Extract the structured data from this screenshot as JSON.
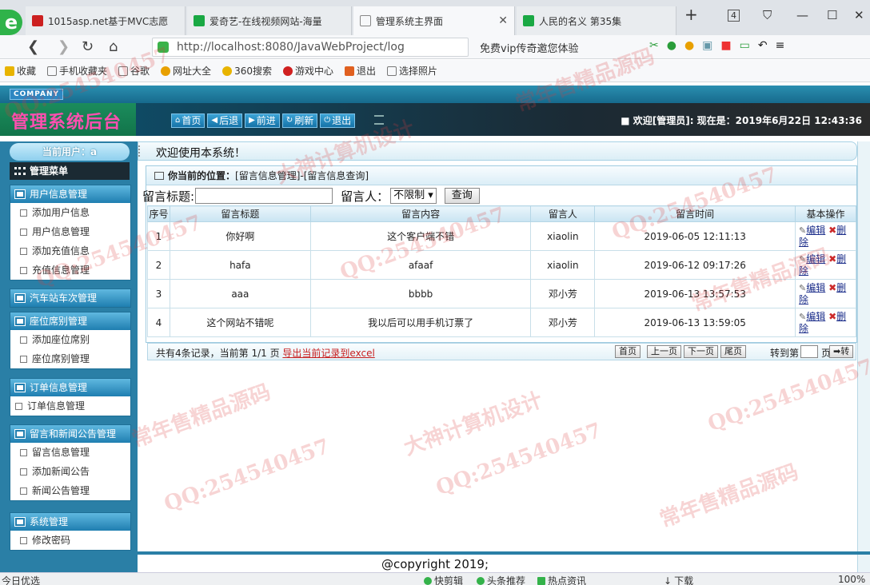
{
  "browser": {
    "tabs": [
      {
        "title": "1015asp.net基于MVC志愿",
        "color": "#cc2020",
        "active": false
      },
      {
        "title": "爱奇艺-在线视频网站-海量",
        "color": "#19a843",
        "active": false
      },
      {
        "title": "管理系统主界面",
        "color": "#888888",
        "active": true
      },
      {
        "title": "人民的名义 第35集",
        "color": "#19a843",
        "active": false
      }
    ],
    "new_tab": "+",
    "tab_count": "4",
    "url": "http://localhost:8080/JavaWebProject/log",
    "ad_text": "免费vip传奇邀您体验",
    "favorites": [
      "收藏",
      "手机收藏夹",
      "谷歌",
      "网址大全",
      "360搜索",
      "游戏中心",
      "退出",
      "选择照片"
    ]
  },
  "header": {
    "company": "COMPANY",
    "title": "管理系统后台",
    "nav": [
      {
        "label": "首页",
        "icon": "home-icon"
      },
      {
        "label": "后退",
        "icon": "back-icon"
      },
      {
        "label": "前进",
        "icon": "forward-icon"
      },
      {
        "label": "刷新",
        "icon": "refresh-icon"
      },
      {
        "label": "退出",
        "icon": "power-icon"
      }
    ],
    "welcome": "■ 欢迎[管理员]:  现在是：2019年6月22日 12:43:36"
  },
  "sidebar": {
    "current_user": "当前用户：a",
    "menu_title": "管理菜单",
    "groups": [
      {
        "title": "用户信息管理",
        "items": [
          "添加用户信息",
          "用户信息管理",
          "添加充值信息",
          "充值信息管理"
        ]
      },
      {
        "title": "汽车站车次管理",
        "items": []
      },
      {
        "title": "座位席别管理",
        "items": [
          "添加座位席别",
          "座位席别管理"
        ]
      },
      {
        "title": "订单信息管理",
        "items": [
          "订单信息管理"
        ]
      },
      {
        "title": "留言和新闻公告管理",
        "items": [
          "留言信息管理",
          "添加新闻公告",
          "新闻公告管理"
        ]
      },
      {
        "title": "系统管理",
        "items": [
          "修改密码"
        ]
      }
    ]
  },
  "main": {
    "welcome": "欢迎使用本系统！",
    "breadcrumb_label": "你当前的位置：",
    "breadcrumb_path": "[留言信息管理]-[留言信息查询]",
    "search": {
      "title_label": "留言标题:",
      "title_value": "",
      "author_label": "留言人：",
      "author_value": "不限制 ▾",
      "query_label": "查询"
    },
    "columns": [
      "序号",
      "留言标题",
      "留言内容",
      "留言人",
      "留言时间",
      "基本操作"
    ],
    "rows": [
      {
        "no": "1",
        "title": "你好啊",
        "content": "这个客户端不错",
        "author": "xiaolin",
        "time": "2019-06-05 12:11:13"
      },
      {
        "no": "2",
        "title": "hafa",
        "content": "afaaf",
        "author": "xiaolin",
        "time": "2019-06-12 09:17:26"
      },
      {
        "no": "3",
        "title": "aaa",
        "content": "bbbb",
        "author": "邓小芳",
        "time": "2019-06-13 13:57:53"
      },
      {
        "no": "4",
        "title": "这个网站不错呢",
        "content": "我以后可以用手机订票了",
        "author": "邓小芳",
        "time": "2019-06-13 13:59:05"
      }
    ],
    "edit_label": "编辑",
    "delete_label": "删除",
    "pager": {
      "info": "共有4条记录，当前第 1/1 页 ",
      "export": "导出当前记录到excel",
      "first": "首页",
      "prev": "上一页",
      "next": "下一页",
      "last": "尾页",
      "goto": "转到第",
      "page_unit": "页",
      "go": "➡转"
    }
  },
  "footer": "@copyright 2019;",
  "statusbar": {
    "left": "今日优选",
    "items": [
      "快剪辑",
      "头条推荐",
      "热点资讯",
      "下载",
      "100%"
    ]
  },
  "watermarks": [
    "QQ:254540457",
    "大神计算机设计",
    "常年售精品源码"
  ]
}
